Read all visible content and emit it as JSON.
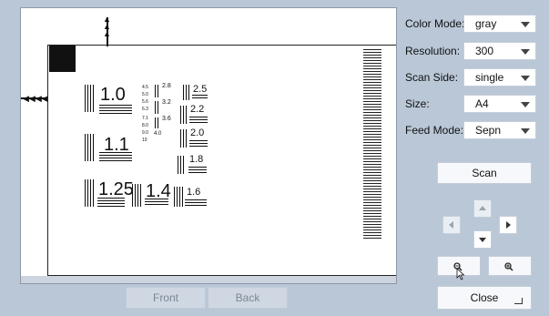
{
  "settings": [
    {
      "label": "Color Mode:",
      "value": "gray"
    },
    {
      "label": "Resolution:",
      "value": "300"
    },
    {
      "label": "Scan Side:",
      "value": "single"
    },
    {
      "label": "Size:",
      "value": "A4"
    },
    {
      "label": "Feed Mode:",
      "value": "Sepn"
    }
  ],
  "buttons": {
    "scan": "Scan",
    "front": "Front",
    "back": "Back",
    "close": "Close"
  },
  "icons": {
    "zoom_out": "zoom-out-icon",
    "zoom_in": "zoom-in-icon",
    "nav_up": "arrow-up-icon",
    "nav_down": "arrow-down-icon",
    "nav_left": "arrow-left-icon",
    "nav_right": "arrow-right-icon",
    "pointer": "mouse-pointer-icon"
  },
  "preview": {
    "chart_labels": [
      "1.0",
      "1.1",
      "1.25",
      "1.4",
      "1.6",
      "1.8",
      "2.0",
      "2.2",
      "2.5",
      "2.8",
      "3.2",
      "3.6",
      "4.0",
      "4.5",
      "5.0",
      "5.6",
      "6.3",
      "7.1",
      "8.0",
      "9.0",
      "10"
    ]
  },
  "colors": {
    "background": "#b9c7d7",
    "button_face": "#f6f8fb",
    "button_disabled": "#cfd8e2"
  }
}
